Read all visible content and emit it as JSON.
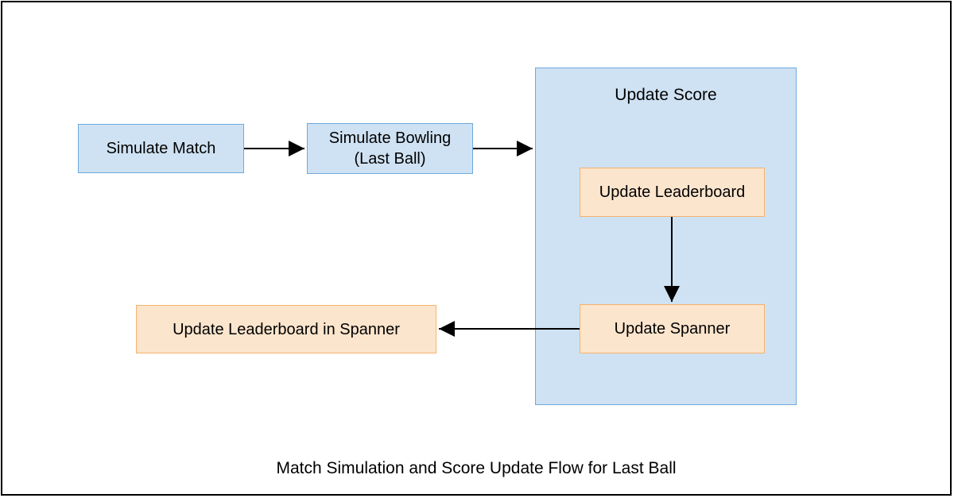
{
  "nodes": {
    "simulate_match": "Simulate Match",
    "simulate_bowling": "Simulate Bowling\n(Last Ball)",
    "update_score": "Update Score",
    "update_leaderboard": "Update Leaderboard",
    "update_spanner": "Update Spanner",
    "update_leaderboard_spanner": "Update Leaderboard in Spanner"
  },
  "caption": "Match Simulation and Score Update Flow for Last Ball",
  "colors": {
    "blue_fill": "#cfe2f3",
    "blue_border": "#6fa8dc",
    "yellow_fill": "#fce5cd",
    "yellow_border": "#f6b26b"
  }
}
